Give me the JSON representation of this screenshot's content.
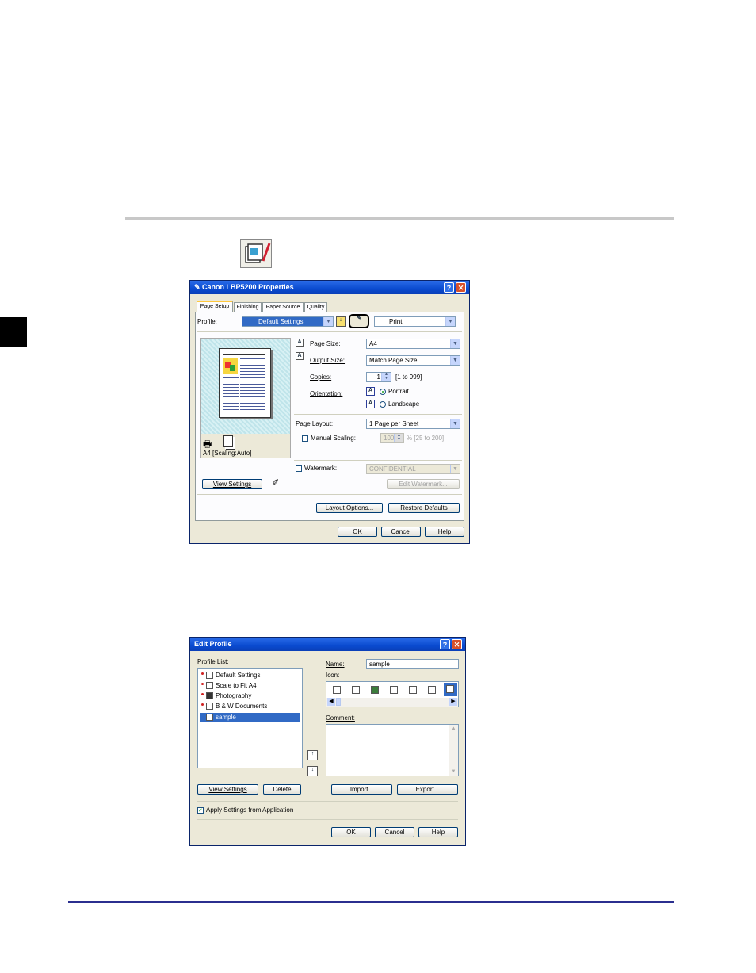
{
  "properties_dialog": {
    "title": "Canon LBP5200 Properties",
    "tabs": [
      "Page Setup",
      "Finishing",
      "Paper Source",
      "Quality"
    ],
    "profile_label": "Profile:",
    "profile_value": "Default Settings",
    "output_method_value": "Print",
    "page_size_label": "Page Size:",
    "page_size_value": "A4",
    "output_size_label": "Output Size:",
    "output_size_value": "Match Page Size",
    "copies_label": "Copies:",
    "copies_value": "1",
    "copies_range": "[1 to 999]",
    "orientation_label": "Orientation:",
    "portrait_label": "Portrait",
    "landscape_label": "Landscape",
    "page_layout_label": "Page Layout:",
    "page_layout_value": "1 Page per Sheet",
    "manual_scaling_label": "Manual Scaling:",
    "scaling_value": "100",
    "scaling_range": "% [25 to 200]",
    "watermark_label": "Watermark:",
    "watermark_value": "CONFIDENTIAL",
    "edit_watermark_button": "Edit Watermark...",
    "preview_caption": "A4 [Scaling:Auto]",
    "view_settings_button": "View Settings",
    "layout_options_button": "Layout Options...",
    "restore_defaults_button": "Restore Defaults",
    "ok_button": "OK",
    "cancel_button": "Cancel",
    "help_button": "Help"
  },
  "edit_profile_dialog": {
    "title": "Edit Profile",
    "profile_list_label": "Profile List:",
    "profiles": [
      "Default Settings",
      "Scale to Fit A4",
      "Photography",
      "B & W Documents",
      "sample"
    ],
    "selected_profile": "sample",
    "name_label": "Name:",
    "name_value": "sample",
    "icon_label": "Icon:",
    "comment_label": "Comment:",
    "view_settings_button": "View Settings",
    "delete_button": "Delete",
    "import_button": "Import...",
    "export_button": "Export...",
    "apply_settings_label": "Apply Settings from Application",
    "ok_button": "OK",
    "cancel_button": "Cancel",
    "help_button": "Help"
  }
}
